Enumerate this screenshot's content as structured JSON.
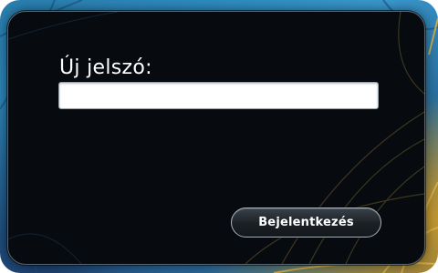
{
  "dialog": {
    "prompt_label": "Új jelszó:",
    "password_value": "",
    "login_button_label": "Bejelentkezés"
  },
  "colors": {
    "dialog_background": "#070b10",
    "wallpaper_blue": "#2f8fc4",
    "wallpaper_gold": "#c79a2e"
  }
}
